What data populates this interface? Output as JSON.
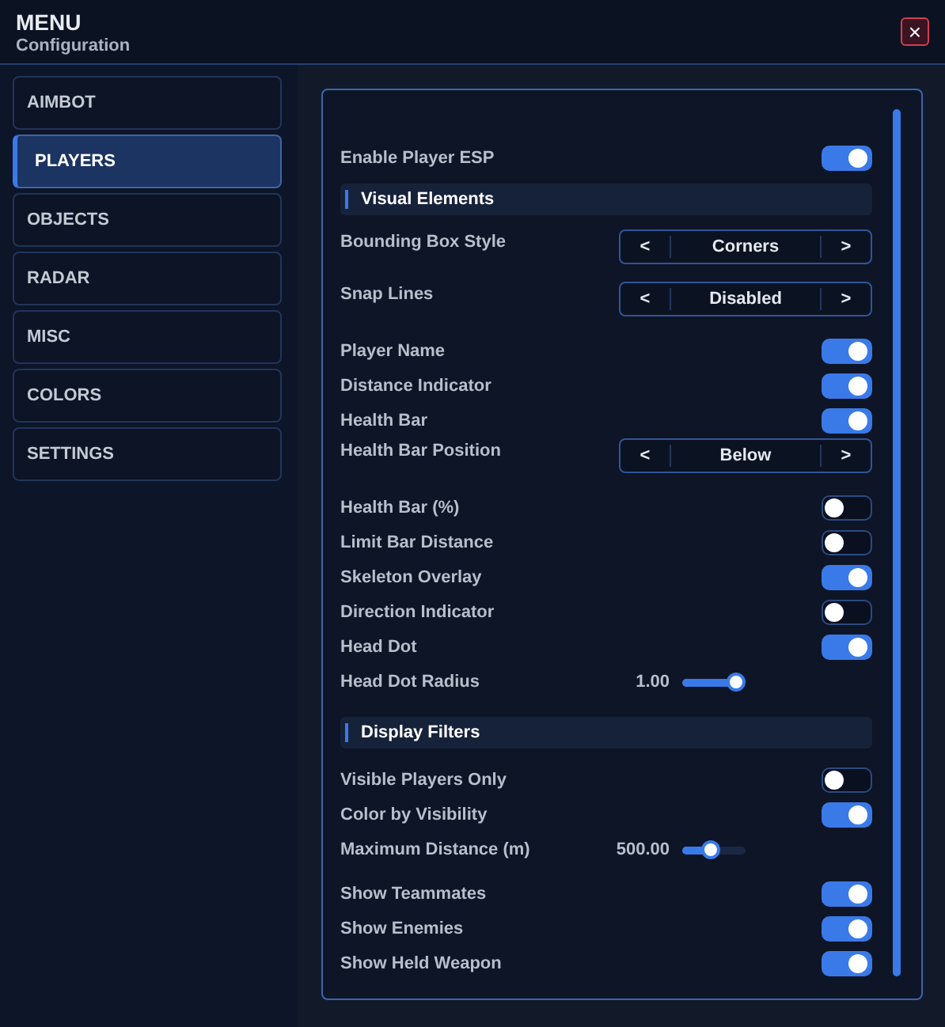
{
  "header": {
    "title": "MENU",
    "subtitle": "Configuration",
    "close": "×"
  },
  "sidebar": {
    "items": [
      {
        "label": "AIMBOT",
        "selected": false
      },
      {
        "label": "PLAYERS",
        "selected": true
      },
      {
        "label": "OBJECTS",
        "selected": false
      },
      {
        "label": "RADAR",
        "selected": false
      },
      {
        "label": "MISC",
        "selected": false
      },
      {
        "label": "COLORS",
        "selected": false
      },
      {
        "label": "SETTINGS",
        "selected": false
      }
    ]
  },
  "settings": [
    {
      "kind": "toggle",
      "label": "Enable Player ESP",
      "on": true
    },
    {
      "kind": "section",
      "label": "Visual Elements"
    },
    {
      "kind": "selector",
      "label": "Bounding Box Style",
      "prev": "<",
      "value": "Corners",
      "next": ">"
    },
    {
      "kind": "selector",
      "label": "Snap Lines",
      "prev": "<",
      "value": "Disabled",
      "next": ">"
    },
    {
      "kind": "toggle",
      "label": "Player Name",
      "on": true
    },
    {
      "kind": "toggle",
      "label": "Distance Indicator",
      "on": true
    },
    {
      "kind": "toggle",
      "label": "Health Bar",
      "on": true
    },
    {
      "kind": "selector",
      "label": "Health Bar Position",
      "prev": "<",
      "value": "Below",
      "next": ">"
    },
    {
      "kind": "toggle",
      "label": "Health Bar (%)",
      "on": false
    },
    {
      "kind": "toggle",
      "label": "Limit Bar Distance",
      "on": false
    },
    {
      "kind": "toggle",
      "label": "Skeleton Overlay",
      "on": true
    },
    {
      "kind": "toggle",
      "label": "Direction Indicator",
      "on": false
    },
    {
      "kind": "toggle",
      "label": "Head Dot",
      "on": true
    },
    {
      "kind": "slider",
      "label": "Head Dot Radius",
      "reading": "1.00",
      "level": 0.85
    },
    {
      "kind": "section",
      "label": "Display Filters"
    },
    {
      "kind": "toggle",
      "label": "Visible Players Only",
      "on": false
    },
    {
      "kind": "toggle",
      "label": "Color by Visibility",
      "on": true
    },
    {
      "kind": "slider",
      "label": "Maximum Distance (m)",
      "reading": "500.00",
      "level": 0.45
    },
    {
      "kind": "toggle",
      "label": "Show Teammates",
      "on": true
    },
    {
      "kind": "toggle",
      "label": "Show Enemies",
      "on": true
    },
    {
      "kind": "toggle",
      "label": "Show Held Weapon",
      "on": true
    }
  ]
}
